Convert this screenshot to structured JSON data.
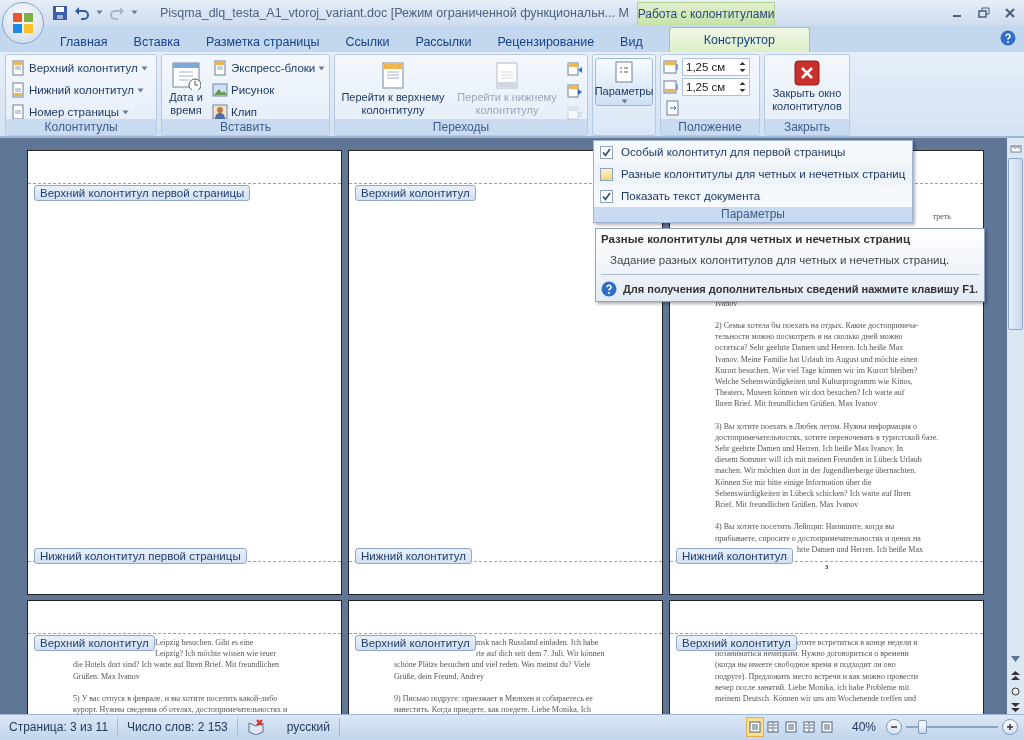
{
  "title_bar": {
    "title": "Pisqma_dlq_testa_A1_vtoroj_variant.doc [Режим ограниченной функциональн... M",
    "context_title": "Работа с колонтитулами"
  },
  "tabs": [
    {
      "label": "Главная",
      "selected": false,
      "kind": "standard"
    },
    {
      "label": "Вставка",
      "selected": false,
      "kind": "standard"
    },
    {
      "label": "Разметка страницы",
      "selected": false,
      "kind": "standard"
    },
    {
      "label": "Ссылки",
      "selected": false,
      "kind": "standard"
    },
    {
      "label": "Рассылки",
      "selected": false,
      "kind": "standard"
    },
    {
      "label": "Рецензирование",
      "selected": false,
      "kind": "standard"
    },
    {
      "label": "Вид",
      "selected": false,
      "kind": "standard"
    },
    {
      "label": "Конструктор",
      "selected": true,
      "kind": "context"
    }
  ],
  "ribbon": {
    "groups": [
      {
        "kind": "header-footer",
        "label": "Колонтитулы",
        "items": [
          {
            "label": "Верхний колонтитул",
            "dropdown": true
          },
          {
            "label": "Нижний колонтитул",
            "dropdown": true
          },
          {
            "label": "Номер страницы",
            "dropdown": true
          }
        ]
      },
      {
        "kind": "insert",
        "label": "Вставить",
        "big": "Дата и время",
        "items": [
          {
            "label": "Экспресс-блоки",
            "dropdown": true
          },
          {
            "label": "Рисунок",
            "dropdown": false
          },
          {
            "label": "Клип",
            "dropdown": false
          }
        ]
      },
      {
        "kind": "navigation",
        "label": "Переходы",
        "buttons": [
          {
            "label": "Перейти к верхнему колонтитулу",
            "disabled": false
          },
          {
            "label": "Перейти к нижнему колонтитулу",
            "disabled": true
          }
        ],
        "tools": [
          {
            "disabled": false
          },
          {
            "disabled": false
          },
          {
            "disabled": true
          }
        ]
      },
      {
        "kind": "options",
        "button": "Параметры",
        "expanded": true
      },
      {
        "kind": "position",
        "label": "Положение",
        "fields": [
          "1,25 см",
          "1,25 см"
        ]
      },
      {
        "kind": "close",
        "label": "Закрыть",
        "button": "Закрыть окно колонтитулов"
      }
    ]
  },
  "dropdown": {
    "checkboxes": [
      {
        "label": "Особый колонтитул для первой страницы",
        "checked": true,
        "highlighted": false
      },
      {
        "label": "Разные колонтитулы для четных и нечетных страниц",
        "checked": false,
        "highlighted": true
      },
      {
        "label": "Показать текст документа",
        "checked": true,
        "highlighted": false
      }
    ],
    "label": "Параметры"
  },
  "tooltip": {
    "title": "Разные колонтитулы для четных и нечетных страниц",
    "description": "Задание разных колонтитулов для четных и нечетных страниц.",
    "help": "Для получения дополнительных сведений нажмите клавишу F1."
  },
  "pages": [
    {
      "header_label": "Верхний колонтитул первой страницы",
      "footer_label": "Нижний колонтитул первой страницы"
    },
    {
      "header_label": "Верхний колонтитул",
      "footer_label": "Нижний колонтитул"
    },
    {
      "footer_label": "Нижний колонтитул",
      "page_number": "3",
      "tail": "треть",
      "paragraphs": [
        {
          "lines": [
            "Ivanov"
          ]
        },
        {
          "lines": [
            "2) Семья хотела бы поехать на отдых. Какие достопримеча-",
            "тельности можно посмотреть и на сколько дней можно",
            "остаться? Sehr geehrte Damen und Herren. Ich heiße Max",
            "Ivanov. Meine Familie hat Urlaub im August und möchte einen",
            "Kurort besuchen. Wie viel Tage können wir im Kurort bleiben?",
            "Welche Sehenswürdigkeiten und Kulturprogramm wie Kinos,",
            "Theaters, Museen können wir dort besuchen? Ich warte auf",
            "Ihren Brief. Mit freundlichen Grüßen. Max Ivanov"
          ]
        },
        {
          "lines": [
            "3) Вы хотите поехать в Любек летом. Нужна информация о",
            "достопримечательностях, хотите переночевать в туристской базе.",
            "Sehr geehrte Damen und Herren. Ich heiße Max Ivanov. In",
            "diesem Sommer will ich mit meinen Freunden in Lübeck Urlaub",
            "machen. Wir möchten dort in der Jugendherberge übernachten.",
            "Können Sie mir bitte einige Information über die",
            "Sehenswürdigkeiten in Lübeck schicken? Ich warte auf Ihren",
            "Brief. Mit freundlichen Grüßen. Max Ivanov"
          ]
        },
        {
          "lines": [
            "4) Вы хотите посетить Лейпциг. Напишите, когда вы",
            "прибываете, спросите о достопримечательностях и ценах на"
          ],
          "covered_after": [
            "hrte Damen und Herren. Ich heiße Max"
          ]
        }
      ]
    },
    {
      "header_label": "Верхний колонтитул",
      "paragraphs": [
        {
          "covered_before": [
            "Leipzig besuchen. Gibt es eine",
            "Leipzig? Ich möchte wissen wie teuer"
          ],
          "lines": [
            "die Hotels dort sind? Ich warte auf Ihren Brief. Mit freundlichen",
            "Grüßen. Max Ivanov"
          ]
        },
        {
          "lines": [
            "5) У вас отпуск в феврале, и вы хотите посетить какой-либо",
            "курорт. Нужны сведения об отелях, достопримечательностях и"
          ]
        }
      ]
    },
    {
      "header_label": "Верхний колонтитул",
      "paragraphs": [
        {
          "covered_before": [
            "msk nach Russland einladen. Ich habe",
            "rte auf dich seit dem 7. Juli. Wir können"
          ],
          "lines": [
            "schöne Plätze besuchen und viel reden. Was meinst du? Viele",
            "Grüße, dein Freund, Andrey"
          ]
        },
        {
          "lines": [
            "9) Письмо подруге: приезжает в Мюнхен и собираетесь ее",
            "навестить. Когда приедете, как поедете. Liebe Monika, Ich"
          ]
        }
      ]
    },
    {
      "header_label": "Верхний колонтитул",
      "paragraphs": [
        {
          "covered_before": [
            "отите встретиться в конце недели и"
          ],
          "lines": [
            "позаниматься немецким. Нужно договориться о времени",
            "(когда вы имеете свободное время и подходит ли оно",
            "подруге). Предложить место встречи и как можно провести",
            "вечер после занятий. Liebe Monika, ich habe Probleme mit",
            "meinem Deutsch. Können wir uns am Wochenende treffen und"
          ]
        }
      ]
    }
  ],
  "status_bar": {
    "page": "Страница: 3 из 11",
    "words": "Число слов: 2 153",
    "language": "русский",
    "views": [
      {
        "selected": true
      },
      {
        "selected": false
      },
      {
        "selected": false
      },
      {
        "selected": false
      },
      {
        "selected": false
      }
    ],
    "zoom": "40%",
    "zoom_slider": {
      "level": 0.17
    }
  }
}
